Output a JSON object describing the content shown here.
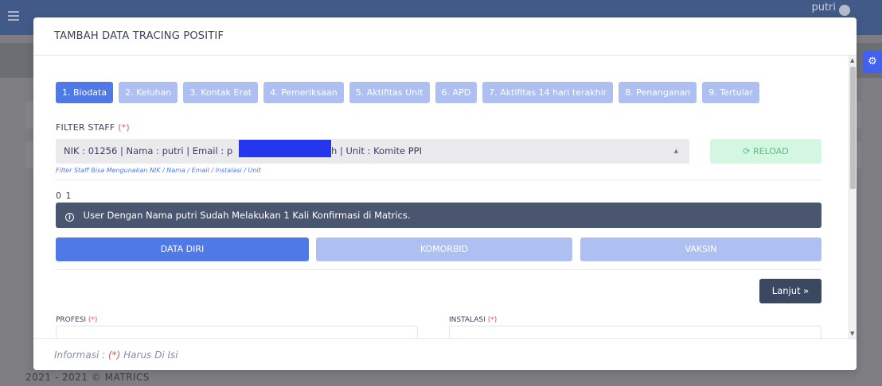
{
  "background": {
    "user_name": "putri",
    "footer_text": "2021 - 2021 © MATRICS",
    "settings_icon": "gear-icon"
  },
  "modal": {
    "title": "TAMBAH DATA TRACING POSITIF",
    "tabs": [
      {
        "label": "1. Biodata",
        "active": true
      },
      {
        "label": "2. Keluhan",
        "active": false
      },
      {
        "label": "3. Kontak Erat",
        "active": false
      },
      {
        "label": "4. Pemeriksaan",
        "active": false
      },
      {
        "label": "5. Aktifitas Unit",
        "active": false
      },
      {
        "label": "6. APD",
        "active": false
      },
      {
        "label": "7. Aktifitas 14 hari terakhir",
        "active": false
      },
      {
        "label": "8. Penanganan",
        "active": false
      },
      {
        "label": "9. Tertular",
        "active": false
      }
    ],
    "filter": {
      "label": "FILTER STAFF",
      "required_mark": "(*)",
      "value_before": "NIK : 01256 | Nama : putri | Email : p",
      "value_after": "h | Unit : Komite PPI",
      "hint": "Filter Staff Bisa Mengunakan NIK / Nama / Email / Instalasi / Unit",
      "reload_label": "RELOAD"
    },
    "counter": "0 1",
    "alert": {
      "text": "User Dengan Nama putri Sudah Melakukan 1 Kali Konfirmasi di Matrics."
    },
    "sub_tabs": [
      {
        "label": "DATA DIRI",
        "active": true
      },
      {
        "label": "KOMORBID",
        "active": false
      },
      {
        "label": "VAKSIN",
        "active": false
      }
    ],
    "next_label": "Lanjut »",
    "fields": {
      "profesi_label": "PROFESI",
      "instalasi_label": "INSTALASI",
      "required_mark": "(*)"
    },
    "footer": {
      "prefix": "Informasi : ",
      "required_mark": "(*)",
      "suffix": " Harus Di Isi"
    }
  },
  "colors": {
    "primary": "#4f79e6",
    "primary_light": "#aec0f2",
    "success_light": "#d4f7e2",
    "success_text": "#55c185",
    "dark": "#3a4862",
    "required": "#e7515a"
  }
}
